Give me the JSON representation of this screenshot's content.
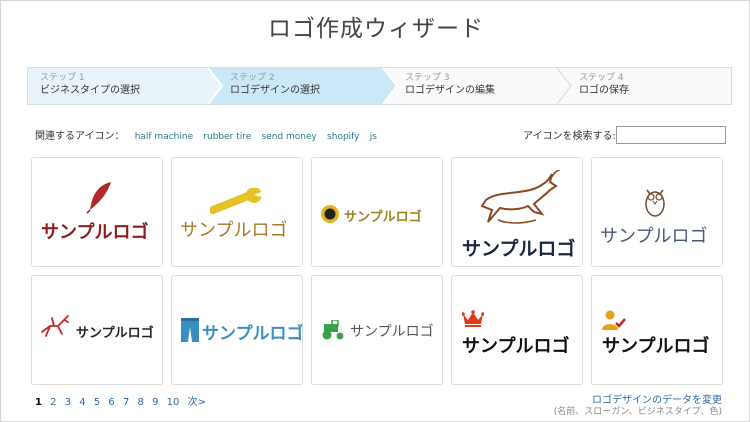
{
  "title": "ロゴ作成ウィザード",
  "steps": [
    {
      "num": "ステップ 1",
      "label": "ビジネスタイプの選択"
    },
    {
      "num": "ステップ 2",
      "label": "ロゴデザインの選択"
    },
    {
      "num": "ステップ 3",
      "label": "ロゴデザインの編集"
    },
    {
      "num": "ステップ 4",
      "label": "ロゴの保存"
    }
  ],
  "related": {
    "label": "関連するアイコン：",
    "tags": [
      "half machine",
      "rubber tire",
      "send money",
      "shopify",
      "js"
    ]
  },
  "search": {
    "label": "アイコンを検索する:",
    "value": ""
  },
  "logos": [
    {
      "text": "サンプルロゴ",
      "icon": "feather-quill-icon",
      "color": "#8b1f1f"
    },
    {
      "text": "サンプルロゴ",
      "icon": "wrench-icon",
      "color": "#a8772a"
    },
    {
      "text": "サンプルロゴ",
      "icon": "sun-circle-icon",
      "color": "#9a8220"
    },
    {
      "text": "サンプルロゴ",
      "icon": "gazelle-icon",
      "color": "#1a2540"
    },
    {
      "text": "サンプルロゴ",
      "icon": "owl-icon",
      "color": "#4a5a7a"
    },
    {
      "text": "サンプルロゴ",
      "icon": "leaping-deer-icon",
      "color": "#222222"
    },
    {
      "text": "サンプルロゴ",
      "icon": "jeans-icon",
      "color": "#3a8fc0"
    },
    {
      "text": "サンプルロゴ",
      "icon": "tractor-icon",
      "color": "#555555"
    },
    {
      "text": "サンプルロゴ",
      "icon": "crown-icon",
      "color": "#111111"
    },
    {
      "text": "サンプルロゴ",
      "icon": "person-check-icon",
      "color": "#111111"
    }
  ],
  "pagination": {
    "pages": [
      "1",
      "2",
      "3",
      "4",
      "5",
      "6",
      "7",
      "8",
      "9",
      "10"
    ],
    "next": "次>",
    "current": "1"
  },
  "change": {
    "link": "ロゴデザインのデータを変更",
    "sub": "(名前、スローガン、ビジネスタイプ、色)"
  }
}
